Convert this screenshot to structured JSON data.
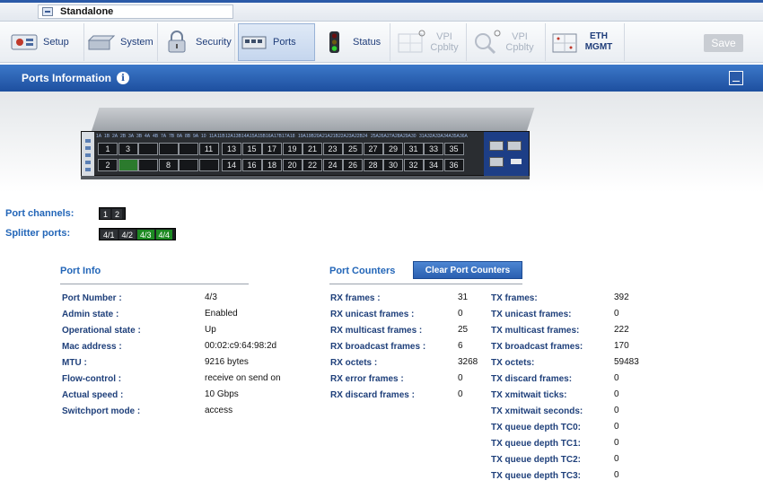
{
  "topbar": {
    "mode_label": "Standalone"
  },
  "toolbar": {
    "items": [
      {
        "label": "Setup",
        "icon": "setup-icon"
      },
      {
        "label": "System",
        "icon": "system-icon"
      },
      {
        "label": "Security",
        "icon": "lock-icon"
      },
      {
        "label": "Ports",
        "icon": "ports-icon",
        "active": true
      },
      {
        "label": "Status",
        "icon": "traffic-light-icon"
      },
      {
        "label": "VPI Cpblty",
        "icon": "vpi-grid-icon",
        "disabled": true
      },
      {
        "label": "VPI Cpblty",
        "icon": "vpi-magnifier-icon",
        "disabled": true
      },
      {
        "label": "ETH MGMT",
        "icon": "eth-mgmt-icon"
      }
    ],
    "save_label": "Save"
  },
  "section": {
    "title": "Ports Information",
    "info_icon": "i"
  },
  "switch_panel": {
    "port_headers": [
      "1A",
      "1B",
      "2A",
      "2B",
      "3A",
      "3B",
      "4A",
      "4B",
      "7A",
      "7B",
      "8A",
      "8B",
      "9A",
      "10",
      "11A",
      "11B",
      "12A",
      "13B",
      "14A",
      "15A",
      "15B",
      "16A",
      "17B",
      "17A",
      "18",
      "19A",
      "19B",
      "20A",
      "21A",
      "21B",
      "22A",
      "23A",
      "22B",
      "24",
      "25A",
      "26A",
      "27A",
      "28A",
      "29A",
      "30",
      "31A",
      "32A",
      "33A",
      "34A",
      "35A",
      "36A"
    ],
    "top_row": [
      "1",
      "3",
      "",
      "",
      "",
      "11",
      "13",
      "15",
      "17",
      "19",
      "21",
      "23",
      "25",
      "27",
      "29",
      "31",
      "33",
      "35"
    ],
    "bottom_row": [
      "2",
      "",
      "",
      "8",
      "",
      "",
      "14",
      "16",
      "18",
      "20",
      "22",
      "24",
      "26",
      "28",
      "30",
      "32",
      "34",
      "36"
    ]
  },
  "port_channels": {
    "label": "Port channels:",
    "items": [
      "1",
      "2"
    ]
  },
  "splitter_ports": {
    "label": "Splitter ports:",
    "items": [
      "4/1",
      "4/2",
      "4/3",
      "4/4"
    ]
  },
  "port_info": {
    "title": "Port Info",
    "rows": [
      {
        "label": "Port Number :",
        "value": "4/3"
      },
      {
        "label": "Admin state :",
        "value": "Enabled"
      },
      {
        "label": "Operational state :",
        "value": "Up"
      },
      {
        "label": "Mac address :",
        "value": "00:02:c9:64:98:2d"
      },
      {
        "label": "MTU :",
        "value": "9216 bytes"
      },
      {
        "label": "Flow-control :",
        "value": "receive on send on"
      },
      {
        "label": "Actual speed :",
        "value": "10 Gbps"
      },
      {
        "label": "Switchport mode :",
        "value": "access"
      }
    ]
  },
  "port_counters": {
    "title": "Port Counters",
    "clear_label": "Clear Port Counters",
    "rx": [
      {
        "label": "RX frames :",
        "value": "31"
      },
      {
        "label": "RX unicast frames :",
        "value": "0"
      },
      {
        "label": "RX multicast frames :",
        "value": "25"
      },
      {
        "label": "RX broadcast frames :",
        "value": "6"
      },
      {
        "label": "RX octets :",
        "value": "3268"
      },
      {
        "label": "RX error frames :",
        "value": "0"
      },
      {
        "label": "RX discard frames :",
        "value": "0"
      }
    ],
    "tx": [
      {
        "label": "TX frames:",
        "value": "392"
      },
      {
        "label": "TX unicast frames:",
        "value": "0"
      },
      {
        "label": "TX multicast frames:",
        "value": "222"
      },
      {
        "label": "TX broadcast frames:",
        "value": "170"
      },
      {
        "label": "TX octets:",
        "value": "59483"
      },
      {
        "label": "TX discard frames:",
        "value": "0"
      },
      {
        "label": "TX xmitwait ticks:",
        "value": "0"
      },
      {
        "label": "TX xmitwait seconds:",
        "value": "0"
      },
      {
        "label": "TX queue depth TC0:",
        "value": "0"
      },
      {
        "label": "TX queue depth TC1:",
        "value": "0"
      },
      {
        "label": "TX queue depth TC2:",
        "value": "0"
      },
      {
        "label": "TX queue depth TC3:",
        "value": "0"
      }
    ]
  }
}
